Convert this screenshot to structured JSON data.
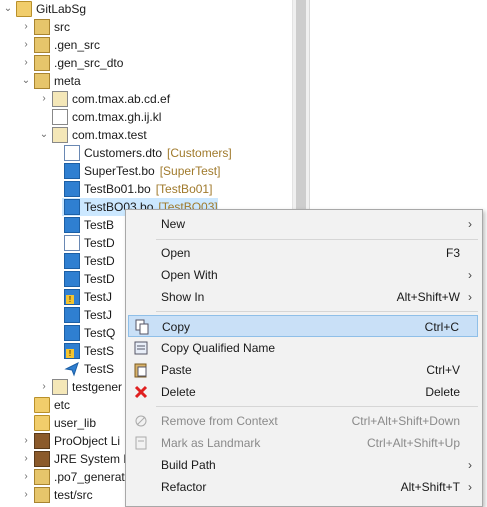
{
  "tree": {
    "items": [
      {
        "label": "GitLabSg",
        "toggle": "expanded",
        "icon": "project-folder-icon",
        "decorator": ""
      },
      {
        "label": "src",
        "toggle": "collapsed",
        "icon": "source-folder-icon",
        "decorator": ""
      },
      {
        "label": ".gen_src",
        "toggle": "collapsed",
        "icon": "source-folder-icon",
        "decorator": ""
      },
      {
        "label": ".gen_src_dto",
        "toggle": "collapsed",
        "icon": "source-folder-icon",
        "decorator": ""
      },
      {
        "label": "meta",
        "toggle": "expanded",
        "icon": "source-folder-icon",
        "decorator": ""
      },
      {
        "label": "com.tmax.ab.cd.ef",
        "toggle": "collapsed",
        "icon": "package-icon",
        "decorator": ""
      },
      {
        "label": "com.tmax.gh.ij.kl",
        "toggle": "none",
        "icon": "empty-package-icon",
        "decorator": ""
      },
      {
        "label": "com.tmax.test",
        "toggle": "expanded",
        "icon": "package-icon",
        "decorator": ""
      },
      {
        "label": "Customers.dto",
        "toggle": "none",
        "icon": "dto-file-icon",
        "decorator": "[Customers]"
      },
      {
        "label": "SuperTest.bo",
        "toggle": "none",
        "icon": "bo-file-icon",
        "decorator": "[SuperTest]"
      },
      {
        "label": "TestBo01.bo",
        "toggle": "none",
        "icon": "bo-file-icon",
        "decorator": "[TestBo01]"
      },
      {
        "label": "TestBO03.bo",
        "toggle": "none",
        "icon": "bo-file-icon",
        "decorator": "[TestBO03]"
      },
      {
        "label": "TestB",
        "toggle": "none",
        "icon": "bo-file-icon",
        "decorator": ""
      },
      {
        "label": "TestD",
        "toggle": "none",
        "icon": "dto-file-icon",
        "decorator": ""
      },
      {
        "label": "TestD",
        "toggle": "none",
        "icon": "db-file-icon",
        "decorator": ""
      },
      {
        "label": "TestD",
        "toggle": "none",
        "icon": "db-file-icon",
        "decorator": ""
      },
      {
        "label": "TestJ",
        "toggle": "none",
        "icon": "warning-file-icon",
        "decorator": ""
      },
      {
        "label": "TestJ",
        "toggle": "none",
        "icon": "db-file-icon",
        "decorator": ""
      },
      {
        "label": "TestQ",
        "toggle": "none",
        "icon": "db-file-icon",
        "decorator": ""
      },
      {
        "label": "TestS",
        "toggle": "none",
        "icon": "warning-file-icon",
        "decorator": ""
      },
      {
        "label": "TestS",
        "toggle": "none",
        "icon": "service-file-icon",
        "decorator": ""
      },
      {
        "label": "testgener",
        "toggle": "collapsed",
        "icon": "package-icon",
        "decorator": ""
      },
      {
        "label": "etc",
        "toggle": "none",
        "icon": "folder-icon",
        "decorator": ""
      },
      {
        "label": "user_lib",
        "toggle": "none",
        "icon": "folder-icon",
        "decorator": ""
      },
      {
        "label": "ProObject Li",
        "toggle": "collapsed",
        "icon": "library-icon",
        "decorator": ""
      },
      {
        "label": "JRE System L",
        "toggle": "collapsed",
        "icon": "library-icon",
        "decorator": ""
      },
      {
        "label": ".po7_generat",
        "toggle": "collapsed",
        "icon": "source-folder-icon",
        "decorator": ""
      },
      {
        "label": "test/src",
        "toggle": "collapsed",
        "icon": "source-folder-icon",
        "decorator": ""
      }
    ]
  },
  "context_menu": {
    "items": [
      {
        "label": "New",
        "shortcut": "",
        "submenu": true,
        "disabled": false,
        "highlighted": false,
        "icon": ""
      },
      {
        "label": "Open",
        "shortcut": "F3",
        "submenu": false,
        "disabled": false,
        "highlighted": false,
        "icon": ""
      },
      {
        "label": "Open With",
        "shortcut": "",
        "submenu": true,
        "disabled": false,
        "highlighted": false,
        "icon": ""
      },
      {
        "label": "Show In",
        "shortcut": "Alt+Shift+W",
        "submenu": true,
        "disabled": false,
        "highlighted": false,
        "icon": ""
      },
      {
        "label": "Copy",
        "shortcut": "Ctrl+C",
        "submenu": false,
        "disabled": false,
        "highlighted": true,
        "icon": "copy-icon"
      },
      {
        "label": "Copy Qualified Name",
        "shortcut": "",
        "submenu": false,
        "disabled": false,
        "highlighted": false,
        "icon": "copy-qualified-name-icon"
      },
      {
        "label": "Paste",
        "shortcut": "Ctrl+V",
        "submenu": false,
        "disabled": false,
        "highlighted": false,
        "icon": "paste-icon"
      },
      {
        "label": "Delete",
        "shortcut": "Delete",
        "submenu": false,
        "disabled": false,
        "highlighted": false,
        "icon": "delete-icon"
      },
      {
        "label": "Remove from Context",
        "shortcut": "Ctrl+Alt+Shift+Down",
        "submenu": false,
        "disabled": true,
        "highlighted": false,
        "icon": "remove-context-icon"
      },
      {
        "label": "Mark as Landmark",
        "shortcut": "Ctrl+Alt+Shift+Up",
        "submenu": false,
        "disabled": true,
        "highlighted": false,
        "icon": "landmark-icon"
      },
      {
        "label": "Build Path",
        "shortcut": "",
        "submenu": true,
        "disabled": false,
        "highlighted": false,
        "icon": ""
      },
      {
        "label": "Refactor",
        "shortcut": "Alt+Shift+T",
        "submenu": true,
        "disabled": false,
        "highlighted": false,
        "icon": ""
      }
    ]
  },
  "colors": {
    "highlight": "#c9e0f7",
    "selection": "#cce8ff",
    "decorator": "#a07a2c",
    "delete": "#e02020"
  }
}
